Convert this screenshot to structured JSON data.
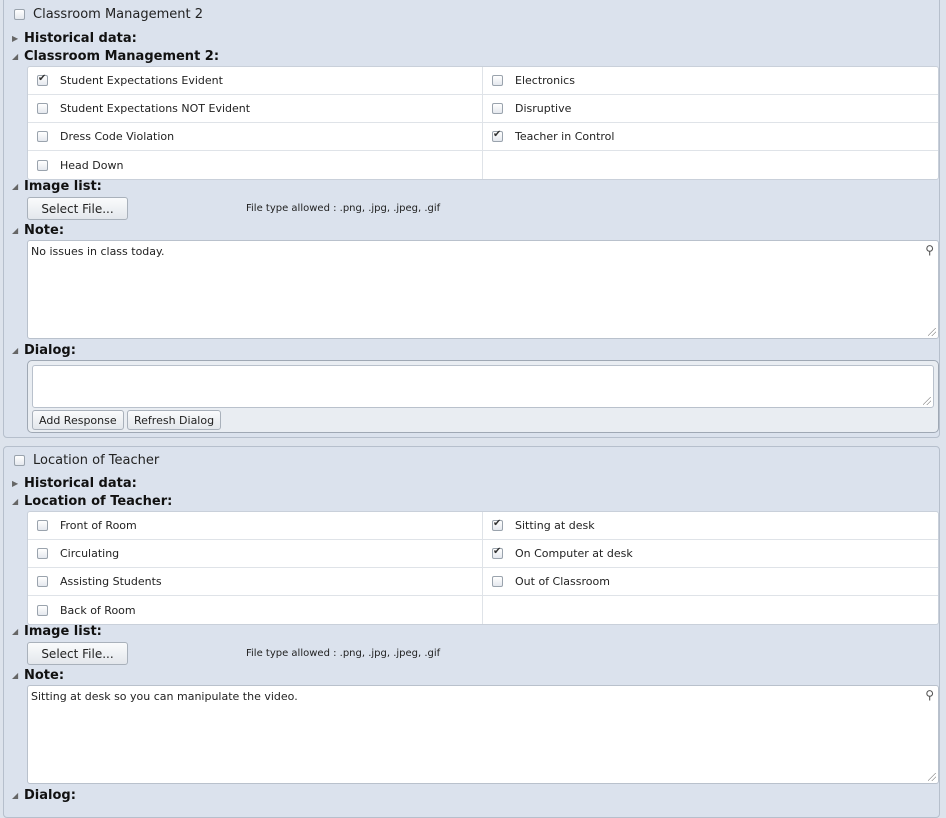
{
  "sections": [
    {
      "title": "Classroom Management 2",
      "title_checked": false,
      "historical_label": "Historical data:",
      "group_label": "Classroom Management 2:",
      "options": [
        [
          {
            "label": "Student Expectations Evident",
            "checked": true
          },
          {
            "label": "Electronics",
            "checked": false
          }
        ],
        [
          {
            "label": "Student Expectations NOT Evident",
            "checked": false
          },
          {
            "label": "Disruptive",
            "checked": false
          }
        ],
        [
          {
            "label": "Dress Code Violation",
            "checked": false
          },
          {
            "label": "Teacher in Control",
            "checked": true
          }
        ],
        [
          {
            "label": "Head Down",
            "checked": false
          },
          {
            "label": "",
            "checked": null
          }
        ]
      ],
      "image_list_label": "Image list:",
      "select_file_label": "Select File...",
      "file_type_text": "File type allowed : .png, .jpg, .jpeg, .gif",
      "note_label": "Note:",
      "note_text": "No issues in class today.",
      "dialog_label": "Dialog:",
      "add_response_label": "Add Response",
      "refresh_dialog_label": "Refresh Dialog"
    },
    {
      "title": "Location of Teacher",
      "title_checked": false,
      "historical_label": "Historical data:",
      "group_label": "Location of Teacher:",
      "options": [
        [
          {
            "label": "Front of Room",
            "checked": false
          },
          {
            "label": "Sitting at desk",
            "checked": true
          }
        ],
        [
          {
            "label": "Circulating",
            "checked": false
          },
          {
            "label": "On Computer at desk",
            "checked": true
          }
        ],
        [
          {
            "label": "Assisting Students",
            "checked": false
          },
          {
            "label": "Out of Classroom",
            "checked": false
          }
        ],
        [
          {
            "label": "Back of Room",
            "checked": false
          },
          {
            "label": "",
            "checked": null
          }
        ]
      ],
      "image_list_label": "Image list:",
      "select_file_label": "Select File...",
      "file_type_text": "File type allowed : .png, .jpg, .jpeg, .gif",
      "note_label": "Note:",
      "note_text": "Sitting at desk so you can manipulate the video.",
      "dialog_label": "Dialog:"
    }
  ],
  "icons": {
    "collapsed_arrow": "triangle-right-icon",
    "expanded_arrow": "triangle-down-icon",
    "comment": "comment-icon",
    "resize": "resize-grip-icon"
  }
}
